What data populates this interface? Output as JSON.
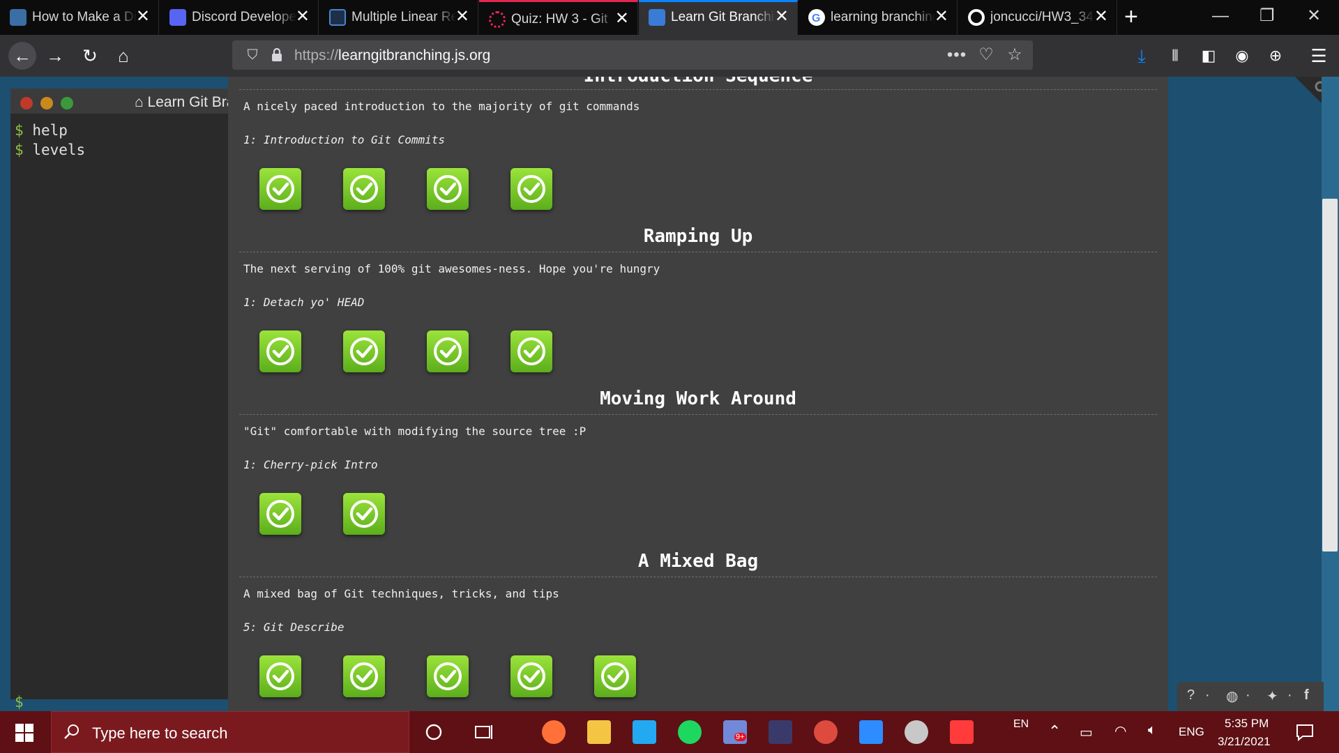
{
  "browser": {
    "tabs": [
      {
        "title": "How to Make a Discord Bot",
        "icon": "python-icon",
        "active": false
      },
      {
        "title": "Discord Developer Portal",
        "icon": "discord-icon",
        "active": false
      },
      {
        "title": "Multiple Linear Regression",
        "icon": "notebook-icon",
        "active": false
      },
      {
        "title": "Quiz: HW 3 - Git",
        "icon": "canvas-icon",
        "active": false
      },
      {
        "title": "Learn Git Branching",
        "icon": "learngit-icon",
        "active": true
      },
      {
        "title": "learning branching",
        "icon": "google-icon",
        "active": false
      },
      {
        "title": "joncucci/HW3_34",
        "icon": "github-icon",
        "active": false
      }
    ],
    "url_protocol": "https://",
    "url_host": "learngitbranching.js.org"
  },
  "terminal": {
    "title": "Learn Git Branching",
    "prompt": "$",
    "lines": [
      "help",
      "levels"
    ]
  },
  "sequences": [
    {
      "name": "Introduction Sequence",
      "description": "A nicely paced introduction to the majority of git commands",
      "about": "1: Introduction to Git Commits",
      "levels_completed": 4
    },
    {
      "name": "Ramping Up",
      "description": "The next serving of 100% git awesomes-ness. Hope you're hungry",
      "about": "1: Detach yo' HEAD",
      "levels_completed": 4
    },
    {
      "name": "Moving Work Around",
      "description": "\"Git\" comfortable with modifying the source tree :P",
      "about": "1: Cherry-pick Intro",
      "levels_completed": 2
    },
    {
      "name": "A Mixed Bag",
      "description": "A mixed bag of Git techniques, tricks, and tips",
      "about": "5: Git Describe",
      "levels_completed": 5
    }
  ],
  "taskbar": {
    "search_placeholder": "Type here to search",
    "ime": "EN",
    "lang": "ENG",
    "time": "5:35 PM",
    "date": "3/21/2021",
    "notification_badge": "9+"
  },
  "colors": {
    "accent": "#0a84ff",
    "level_solved": "#7cc62e",
    "page_bg": "#1c4f70",
    "panel_bg": "#404040",
    "taskbar": "#5e1014"
  }
}
